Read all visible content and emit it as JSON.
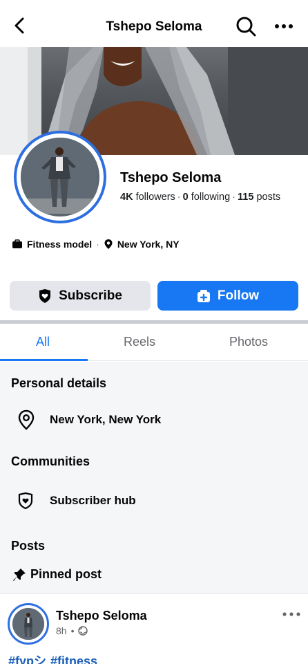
{
  "header": {
    "title": "Tshepo Seloma",
    "back_icon": "chevron-left-icon",
    "search_icon": "search-icon",
    "more_icon": "more-horizontal-icon"
  },
  "profile": {
    "name": "Tshepo Seloma",
    "followers_count": "4K",
    "followers_label": "followers",
    "following_count": "0",
    "following_label": "following",
    "posts_count": "115",
    "posts_label": "posts",
    "category": "Fitness model",
    "location": "New York, NY"
  },
  "actions": {
    "subscribe_label": "Subscribe",
    "follow_label": "Follow"
  },
  "tabs": [
    {
      "label": "All",
      "active": true
    },
    {
      "label": "Reels",
      "active": false
    },
    {
      "label": "Photos",
      "active": false
    }
  ],
  "personal_details": {
    "heading": "Personal details",
    "location": "New York, New York"
  },
  "communities": {
    "heading": "Communities",
    "item": "Subscriber hub"
  },
  "posts": {
    "heading": "Posts",
    "pinned_label": "Pinned post",
    "post": {
      "author": "Tshepo Seloma",
      "time": "8h",
      "hashtags": [
        "#fypシ",
        "#fitness"
      ]
    }
  },
  "colors": {
    "accent": "#1877f2",
    "avatar_ring": "#2d6fe0",
    "secondary_button": "#e4e6eb"
  }
}
